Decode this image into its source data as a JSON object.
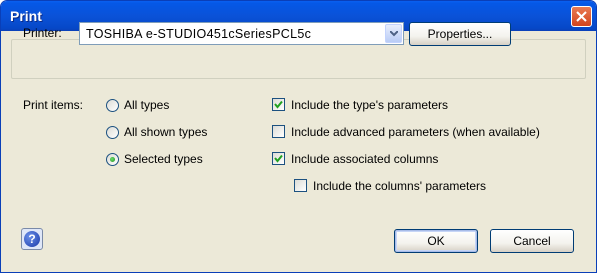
{
  "window": {
    "title": "Print"
  },
  "printer": {
    "label": "Printer:",
    "selected": "TOSHIBA e-STUDIO451cSeriesPCL5c",
    "properties_label": "Properties..."
  },
  "print_items": {
    "label": "Print items:",
    "options": [
      {
        "label": "All types",
        "selected": false
      },
      {
        "label": "All shown types",
        "selected": false
      },
      {
        "label": "Selected types",
        "selected": true
      }
    ]
  },
  "options": {
    "items": [
      {
        "label": "Include the type's parameters",
        "checked": true
      },
      {
        "label": "Include advanced parameters (when available)",
        "checked": false
      },
      {
        "label": "Include associated columns",
        "checked": true
      },
      {
        "label": "Include the columns' parameters",
        "checked": false
      }
    ]
  },
  "buttons": {
    "ok": "OK",
    "cancel": "Cancel"
  },
  "icons": {
    "close": "close-icon",
    "help": "help-icon",
    "dropdown": "chevron-down-icon"
  },
  "colors": {
    "titlebar": "#0a52d8",
    "close": "#d3441c",
    "dialog_bg": "#ece9d8"
  }
}
